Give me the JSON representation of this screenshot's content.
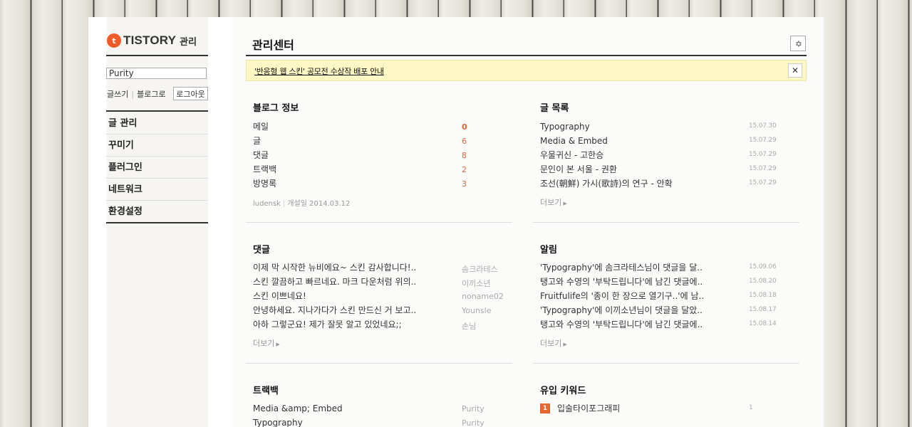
{
  "brand": {
    "logo_text": "TISTORY",
    "logo_mark": "t",
    "admin_label": "관리"
  },
  "sidebar": {
    "blog_name": "Purity",
    "link_write": "글쓰기",
    "link_blog": "블로그로",
    "logout": "로그아웃",
    "menu": [
      {
        "label": "글 관리"
      },
      {
        "label": "꾸미기"
      },
      {
        "label": "플러그인"
      },
      {
        "label": "네트워크"
      },
      {
        "label": "환경설정"
      }
    ]
  },
  "header": {
    "title": "관리센터",
    "settings_icon": "gear-icon"
  },
  "notice": {
    "text": "'반응형 웹 스킨' 공모전 수상작 배포 안내",
    "close": "✕"
  },
  "blog_info": {
    "title": "블로그 정보",
    "rows": [
      {
        "label": "메일",
        "value": "0"
      },
      {
        "label": "글",
        "value": "6"
      },
      {
        "label": "댓글",
        "value": "8"
      },
      {
        "label": "트랙백",
        "value": "2"
      },
      {
        "label": "방명록",
        "value": "3"
      }
    ],
    "owner": "ludensk",
    "opened": "개설일 2014.03.12"
  },
  "posts": {
    "title": "글 목록",
    "rows": [
      {
        "title": "Typography",
        "date": "15.07.30"
      },
      {
        "title": "Media & Embed",
        "date": "15.07.29"
      },
      {
        "title": "우물귀신 - 고한승",
        "date": "15.07.29"
      },
      {
        "title": "문인이 본 서울 - 권환",
        "date": "15.07.29"
      },
      {
        "title": "조선(朝鮮) 가시(歌詩)의 연구 - 안확",
        "date": "15.07.29"
      }
    ],
    "more": "더보기"
  },
  "comments": {
    "title": "댓글",
    "rows": [
      {
        "text": "이제 막 시작한 뉴비에요~ 스킨 감사합니다!..",
        "author": "솜크라테스"
      },
      {
        "text": "스킨 깔끔하고 빠르네요. 마크 다운처럼 위의..",
        "author": "이끼소년"
      },
      {
        "text": "스킨 이쁘네요!",
        "author": "noname02"
      },
      {
        "text": "안녕하세요. 지나가다가 스킨 만드신 거 보고..",
        "author": "Younsle"
      },
      {
        "text": "아하 그렇군요! 제가 잘못 알고 있었네요;;",
        "author": "손님"
      }
    ],
    "more": "더보기"
  },
  "alerts": {
    "title": "알림",
    "rows": [
      {
        "text": "'Typography'에 솜크라테스님이 댓글을 달..",
        "date": "15.09.06"
      },
      {
        "text": "탱고와 수영의 '부탁드립니다'에 남긴 댓글에..",
        "date": "15.08.20"
      },
      {
        "text": "Fruitfulife의 '종이 한 장으로 열기구..'에 남..",
        "date": "15.08.18"
      },
      {
        "text": "'Typography'에 이끼소년님이 댓글을 달았..",
        "date": "15.08.17"
      },
      {
        "text": "탱고와 수영의 '부탁드립니다'에 남긴 댓글에..",
        "date": "15.08.14"
      }
    ],
    "more": "더보기"
  },
  "trackbacks": {
    "title": "트랙백",
    "rows": [
      {
        "text": "Media &amp; Embed",
        "author": "Purity"
      },
      {
        "text": "Typography",
        "author": "Purity"
      }
    ]
  },
  "keywords": {
    "title": "유입 키워드",
    "rows": [
      {
        "rank": "1",
        "text": "입술타이포그래피",
        "count": "1"
      }
    ]
  },
  "colors": {
    "accent": "#e8652d",
    "notice_bg": "#fdf8c4",
    "rule": "#333333"
  }
}
